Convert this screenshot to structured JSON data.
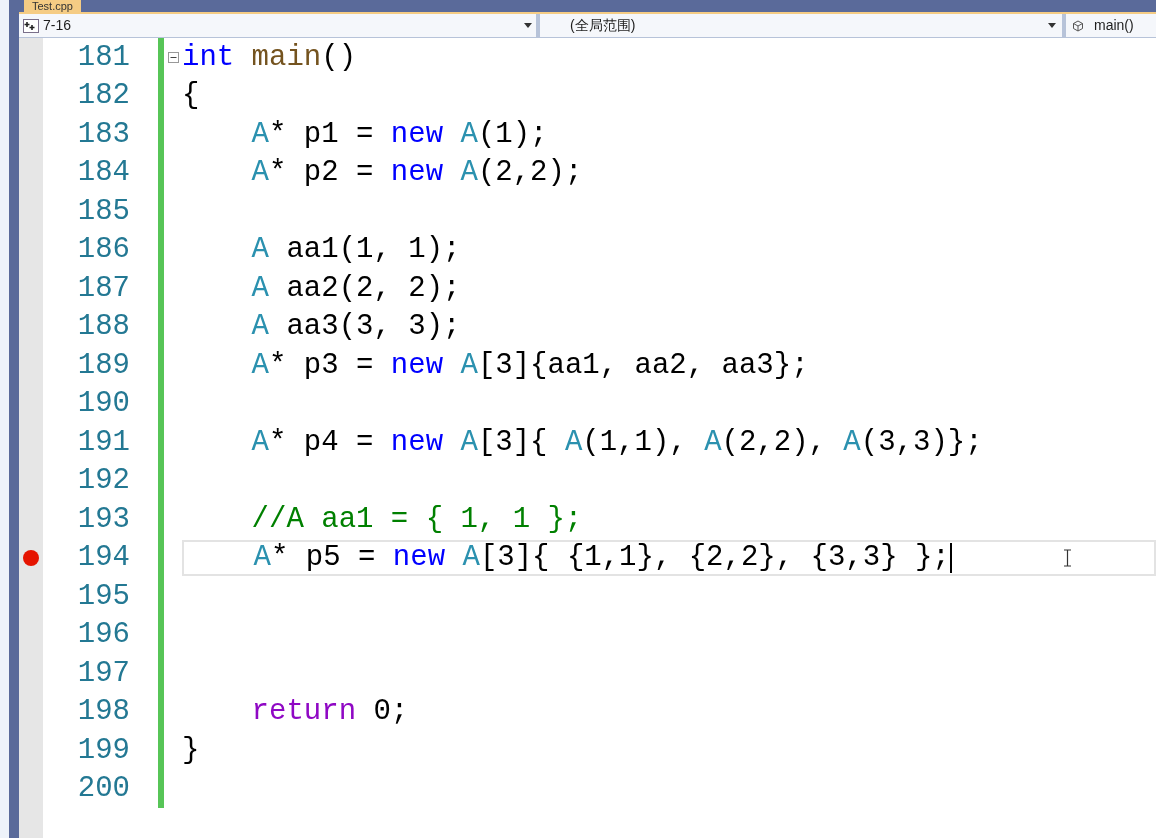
{
  "tab": {
    "title": "Test.cpp"
  },
  "navbar": {
    "project": "7-16",
    "scope": "(全局范围)",
    "member": "main()"
  },
  "lines": [
    {
      "number": "181",
      "breakpoint": false,
      "selected": false,
      "fold": true,
      "tokens": [
        {
          "kind": "keyword",
          "text": "int"
        },
        {
          "kind": "function",
          "text": " main"
        },
        {
          "kind": "plain",
          "text": "()"
        }
      ]
    },
    {
      "number": "182",
      "breakpoint": false,
      "selected": false,
      "fold": false,
      "tokens": [
        {
          "kind": "plain",
          "text": "{"
        }
      ]
    },
    {
      "number": "183",
      "breakpoint": false,
      "selected": false,
      "fold": false,
      "tokens": [
        {
          "kind": "type",
          "text": "    A"
        },
        {
          "kind": "plain",
          "text": "* p1 = "
        },
        {
          "kind": "keyword",
          "text": "new"
        },
        {
          "kind": "type",
          "text": " A"
        },
        {
          "kind": "plain",
          "text": "(1);"
        }
      ]
    },
    {
      "number": "184",
      "breakpoint": false,
      "selected": false,
      "fold": false,
      "tokens": [
        {
          "kind": "type",
          "text": "    A"
        },
        {
          "kind": "plain",
          "text": "* p2 = "
        },
        {
          "kind": "keyword",
          "text": "new"
        },
        {
          "kind": "type",
          "text": " A"
        },
        {
          "kind": "plain",
          "text": "(2,2);"
        }
      ]
    },
    {
      "number": "185",
      "breakpoint": false,
      "selected": false,
      "fold": false
    },
    {
      "number": "186",
      "breakpoint": false,
      "selected": false,
      "fold": false,
      "tokens": [
        {
          "kind": "type",
          "text": "    A"
        },
        {
          "kind": "plain",
          "text": " aa1(1, 1);"
        }
      ]
    },
    {
      "number": "187",
      "breakpoint": false,
      "selected": false,
      "fold": false,
      "tokens": [
        {
          "kind": "type",
          "text": "    A"
        },
        {
          "kind": "plain",
          "text": " aa2(2, 2);"
        }
      ]
    },
    {
      "number": "188",
      "breakpoint": false,
      "selected": false,
      "fold": false,
      "tokens": [
        {
          "kind": "type",
          "text": "    A"
        },
        {
          "kind": "plain",
          "text": " aa3(3, 3);"
        }
      ]
    },
    {
      "number": "189",
      "breakpoint": false,
      "selected": false,
      "fold": false,
      "tokens": [
        {
          "kind": "type",
          "text": "    A"
        },
        {
          "kind": "plain",
          "text": "* p3 = "
        },
        {
          "kind": "keyword",
          "text": "new"
        },
        {
          "kind": "type",
          "text": " A"
        },
        {
          "kind": "plain",
          "text": "[3]{aa1, aa2, aa3};"
        }
      ]
    },
    {
      "number": "190",
      "breakpoint": false,
      "selected": false,
      "fold": false
    },
    {
      "number": "191",
      "breakpoint": false,
      "selected": false,
      "fold": false,
      "tokens": [
        {
          "kind": "type",
          "text": "    A"
        },
        {
          "kind": "plain",
          "text": "* p4 = "
        },
        {
          "kind": "keyword",
          "text": "new"
        },
        {
          "kind": "type",
          "text": " A"
        },
        {
          "kind": "plain",
          "text": "[3]{ "
        },
        {
          "kind": "type",
          "text": "A"
        },
        {
          "kind": "plain",
          "text": "(1,1), "
        },
        {
          "kind": "type",
          "text": "A"
        },
        {
          "kind": "plain",
          "text": "(2,2), "
        },
        {
          "kind": "type",
          "text": "A"
        },
        {
          "kind": "plain",
          "text": "(3,3)};"
        }
      ]
    },
    {
      "number": "192",
      "breakpoint": false,
      "selected": false,
      "fold": false
    },
    {
      "number": "193",
      "breakpoint": false,
      "selected": false,
      "fold": false,
      "tokens": [
        {
          "kind": "comment",
          "text": "    //A aa1 = { 1, 1 };"
        }
      ]
    },
    {
      "number": "194",
      "breakpoint": true,
      "selected": true,
      "fold": false,
      "tokens": [
        {
          "kind": "type",
          "text": "    A"
        },
        {
          "kind": "plain",
          "text": "* p5 = "
        },
        {
          "kind": "keyword",
          "text": "new"
        },
        {
          "kind": "type",
          "text": " A"
        },
        {
          "kind": "plain",
          "text": "[3]{ {1,1}, {2,2}, {3,3} };"
        }
      ]
    },
    {
      "number": "195",
      "breakpoint": false,
      "selected": false,
      "fold": false
    },
    {
      "number": "196",
      "breakpoint": false,
      "selected": false,
      "fold": false
    },
    {
      "number": "197",
      "breakpoint": false,
      "selected": false,
      "fold": false
    },
    {
      "number": "198",
      "breakpoint": false,
      "selected": false,
      "fold": false,
      "tokens": [
        {
          "kind": "control",
          "text": "    return"
        },
        {
          "kind": "plain",
          "text": " 0;"
        }
      ]
    },
    {
      "number": "199",
      "breakpoint": false,
      "selected": false,
      "fold": false,
      "tokens": [
        {
          "kind": "plain",
          "text": "}"
        }
      ]
    },
    {
      "number": "200",
      "breakpoint": false,
      "selected": false,
      "fold": false
    }
  ]
}
